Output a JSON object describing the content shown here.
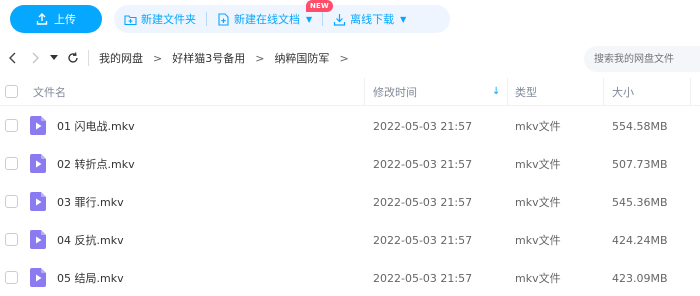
{
  "toolbar": {
    "upload_label": "上传",
    "new_folder_label": "新建文件夹",
    "new_online_doc_label": "新建在线文档",
    "new_badge": "NEW",
    "offline_download_label": "离线下载"
  },
  "breadcrumb": {
    "items": [
      "我的网盘",
      "好样猫3号备用",
      "纳粹国防军"
    ],
    "separator": ">"
  },
  "search": {
    "placeholder": "搜索我的网盘文件"
  },
  "table": {
    "headers": {
      "name": "文件名",
      "modified": "修改时间",
      "type": "类型",
      "size": "大小"
    },
    "rows": [
      {
        "name": "01 闪电战.mkv",
        "modified": "2022-05-03 21:57",
        "type": "mkv文件",
        "size": "554.58MB"
      },
      {
        "name": "02 转折点.mkv",
        "modified": "2022-05-03 21:57",
        "type": "mkv文件",
        "size": "507.73MB"
      },
      {
        "name": "03 罪行.mkv",
        "modified": "2022-05-03 21:57",
        "type": "mkv文件",
        "size": "545.36MB"
      },
      {
        "name": "04 反抗.mkv",
        "modified": "2022-05-03 21:57",
        "type": "mkv文件",
        "size": "424.24MB"
      },
      {
        "name": "05 结局.mkv",
        "modified": "2022-05-03 21:57",
        "type": "mkv文件",
        "size": "423.09MB"
      }
    ]
  },
  "colors": {
    "accent": "#06a7ff",
    "badge": "#ff4d6a",
    "video_icon": "#8a7cf0"
  },
  "icons": {
    "upload": "upload-icon",
    "new_folder": "folder-plus-icon",
    "new_doc": "doc-plus-icon",
    "offline_download": "download-icon",
    "back": "chevron-left-icon",
    "forward": "chevron-right-icon",
    "history": "caret-down-icon",
    "refresh": "refresh-icon",
    "file": "video-file-icon",
    "sort": "sort-down-arrow-icon"
  }
}
